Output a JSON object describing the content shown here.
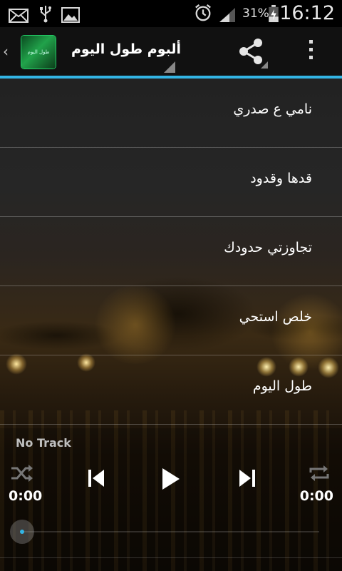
{
  "status_bar": {
    "icons": [
      "mail-icon",
      "usb-icon",
      "image-icon",
      "alarm-icon",
      "signal-icon",
      "battery-charging-icon"
    ],
    "battery": "31%",
    "time": "16:12"
  },
  "action_bar": {
    "title": "ألبوم طول اليوم",
    "logo_text": "طول اليوم"
  },
  "tracks": [
    "نامي ع صدري",
    "قدها وقدود",
    "تجاوزتي حدودك",
    "خلص استحي",
    "طول اليوم"
  ],
  "player": {
    "now_playing": "No Track",
    "elapsed": "0:00",
    "duration": "0:00",
    "progress": 0,
    "accent_color": "#33b5e5"
  }
}
